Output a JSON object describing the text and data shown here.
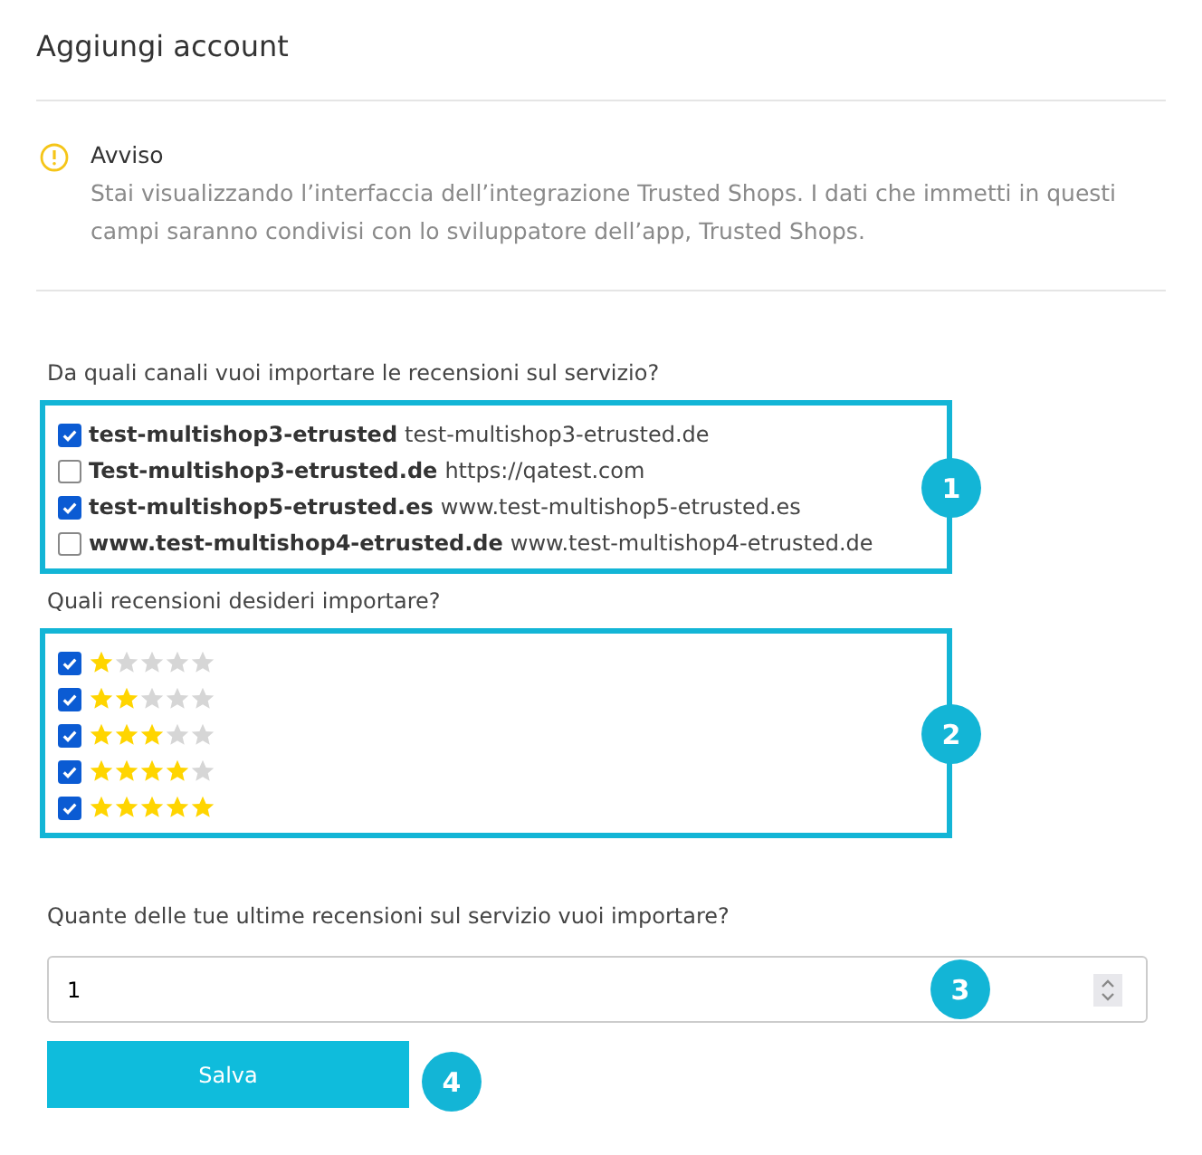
{
  "title": "Aggiungi account",
  "notice": {
    "title": "Avviso",
    "text": "Stai visualizzando l’interfaccia dell’integrazione Trusted Shops. I dati che immetti in questi campi saranno condivisi con lo sviluppatore dell’app, Trusted Shops."
  },
  "channels": {
    "question": "Da quali canali vuoi importare le recensioni sul servizio?",
    "callout": "1",
    "items": [
      {
        "name": "test-multishop3-etrusted",
        "url": "test-multishop3-etrusted.de",
        "checked": true
      },
      {
        "name": "Test-multishop3-etrusted.de",
        "url": "https://qatest.com",
        "checked": false
      },
      {
        "name": "test-multishop5-etrusted.es",
        "url": "www.test-multishop5-etrusted.es",
        "checked": true
      },
      {
        "name": "www.test-multishop4-etrusted.de",
        "url": "www.test-multishop4-etrusted.de",
        "checked": false
      }
    ]
  },
  "ratings": {
    "question": "Quali recensioni desideri importare?",
    "callout": "2",
    "items": [
      {
        "stars": 1,
        "checked": true
      },
      {
        "stars": 2,
        "checked": true
      },
      {
        "stars": 3,
        "checked": true
      },
      {
        "stars": 4,
        "checked": true
      },
      {
        "stars": 5,
        "checked": true
      }
    ]
  },
  "count": {
    "question": "Quante delle tue ultime recensioni sul servizio vuoi importare?",
    "value": "1",
    "callout": "3"
  },
  "save": {
    "label": "Salva",
    "callout": "4"
  }
}
